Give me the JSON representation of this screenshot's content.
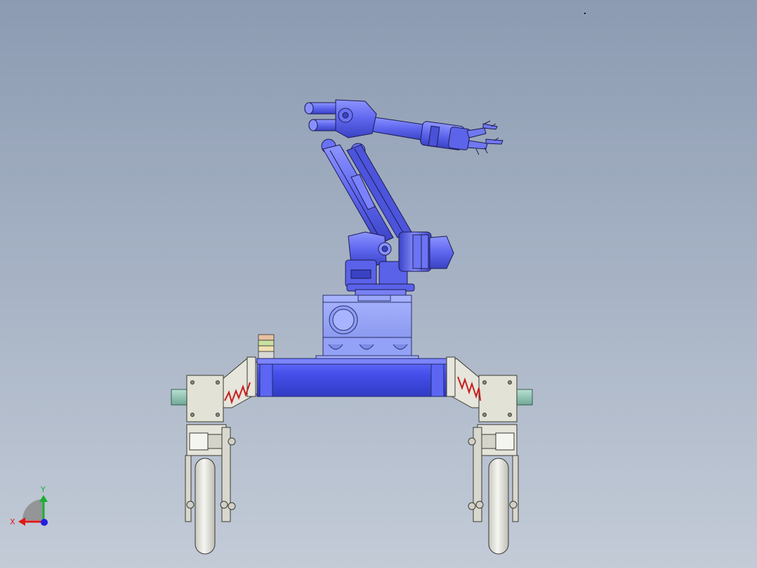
{
  "viewport": {
    "background_top": "#8c9bb2",
    "background_bottom": "#c3cbd7"
  },
  "model": {
    "body_color": "#6a72f0",
    "body_dark": "#3c44c8",
    "chassis_color": "#4c56ea",
    "frame_color": "#e6e6dc",
    "spring_color": "#c81e1e",
    "rail_color": "#8ec4b4",
    "wheel_color": "#eeeeea"
  },
  "triad": {
    "x_label": "X",
    "y_label": "Y",
    "x_color": "#e01818",
    "y_color": "#18b030",
    "z_color": "#2020e0"
  }
}
